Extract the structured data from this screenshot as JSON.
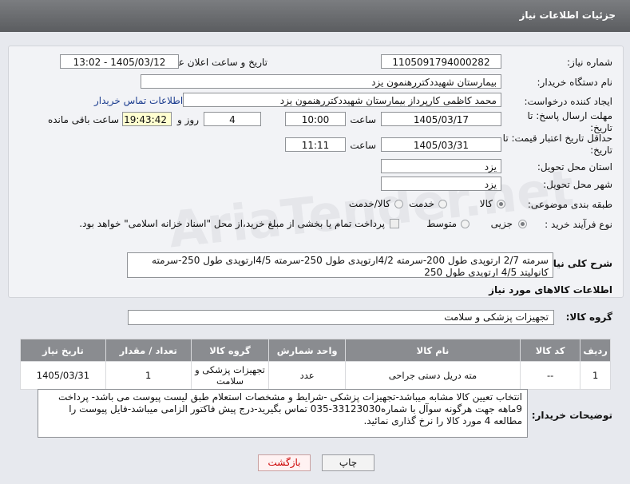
{
  "header": {
    "title": "جزئیات اطلاعات نیاز"
  },
  "watermark": "AriaTender.net",
  "form": {
    "need_number_label": "شماره نیاز:",
    "need_number": "1105091794000282",
    "announce_label": "تاریخ و ساعت اعلان عمومی:",
    "announce_value": "1405/03/12 - 13:02",
    "buyer_label": "نام دستگاه خریدار:",
    "buyer_value": "بیمارستان شهیددکتررهنمون یزد",
    "creator_label": "ایجاد کننده درخواست:",
    "creator_value": "محمد کاظمی کارپرداز بیمارستان شهیددکتررهنمون یزد",
    "contact_link": "اطلاعات تماس خریدار",
    "deadline_label": "مهلت ارسال پاسخ: تا تاریخ:",
    "deadline_date": "1405/03/17",
    "time_label": "ساعت",
    "deadline_time": "10:00",
    "days_value": "4",
    "days_label": "روز و",
    "remaining_time": "19:43:42",
    "remaining_label": "ساعت باقی مانده",
    "validity_label": "حداقل تاریخ اعتبار قیمت: تا تاریخ:",
    "validity_date": "1405/03/31",
    "validity_time": "11:11",
    "province_label": "استان محل تحویل:",
    "province_value": "یزد",
    "city_label": "شهر محل تحویل:",
    "city_value": "یزد",
    "category_label": "طبقه بندی موضوعی:",
    "category_options": [
      "کالا",
      "خدمت",
      "کالا/خدمت"
    ],
    "category_selected": "کالا",
    "process_label": "نوع فرآیند خرید :",
    "process_options": [
      "جزیی",
      "متوسط"
    ],
    "process_selected": "جزیی",
    "payment_note": "پرداخت تمام یا بخشی از مبلغ خرید،از محل \"اسناد خزانه اسلامی\" خواهد بود."
  },
  "summary": {
    "label": "شرح کلی نیاز:",
    "text": "سرمته 2/7 ارتوپدی طول 200-سرمته 4/2ارتوپدی طول 250-سرمته 4/5ارتوپدی طول 250-سرمته کانولیتد 4/5 ارتوپدی طول 250"
  },
  "goods": {
    "section_title": "اطلاعات کالاهای مورد نیاز",
    "group_label": "گروه کالا:",
    "group_value": "تجهیزات پزشکی و سلامت",
    "columns": [
      "ردیف",
      "کد کالا",
      "نام کالا",
      "واحد شمارش",
      "گروه کالا",
      "تعداد / مقدار",
      "تاریخ نیاز"
    ],
    "rows": [
      [
        "1",
        "--",
        "مته دریل دستی جراحی",
        "عدد",
        "تجهیزات پزشکی و سلامت",
        "1",
        "1405/03/31"
      ]
    ]
  },
  "buyer_notes": {
    "label": "توضیحات خریدار:",
    "text": "انتخاب تعیین کالا مشابه میباشد-تجهیزات پزشکی -شرایط و مشخصات استعلام طبق لیست پیوست می باشد- پرداخت 9ماهه جهت هرگونه سوآل با شماره33123030-035 تماس بگیرید-درج پیش فاکتور الزامی میباشد-فایل پیوست را مطالعه 4 مورد کالا را نرخ گذاری نمائید."
  },
  "buttons": {
    "print": "چاپ",
    "back": "بازگشت"
  }
}
